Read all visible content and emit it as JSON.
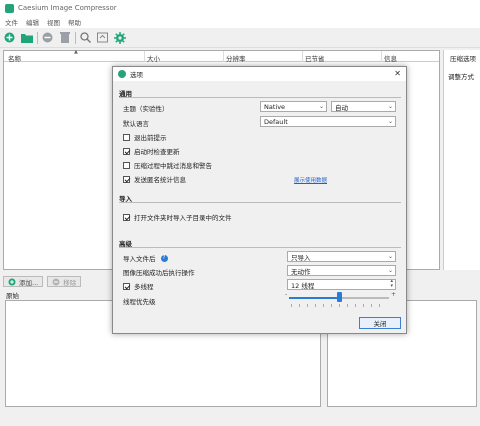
{
  "window": {
    "title": "Caesium Image Compressor"
  },
  "menu": [
    "文件",
    "编辑",
    "视图",
    "帮助"
  ],
  "toolbar": {
    "icons": [
      "add-icon",
      "folder-icon",
      "remove-icon",
      "clear-icon",
      "search-icon",
      "preview-icon",
      "settings-icon"
    ],
    "accent": "#1ea67a"
  },
  "table": {
    "columns": [
      "名称",
      "大小",
      "分辨率",
      "已节省",
      "信息"
    ]
  },
  "right_panel": {
    "title": "压缩选项",
    "tab": "调整方式"
  },
  "bottom": {
    "add_label": "添加...",
    "remove_label": "移除",
    "original_label": "原始"
  },
  "dialog": {
    "title": "选项",
    "general_section": "通用",
    "theme_label": "主题（实验性）",
    "theme_value": "Native",
    "theme_mode_value": "自动",
    "language_label": "默认语言",
    "language_value": "Default",
    "checkboxes": [
      {
        "label": "退出前提示",
        "checked": false
      },
      {
        "label": "启动时检查更新",
        "checked": true
      },
      {
        "label": "压缩过程中跳过消息和警告",
        "checked": false
      },
      {
        "label": "发送匿名统计信息",
        "checked": true
      }
    ],
    "show_data_link": "展示使用数据",
    "import_section": "导入",
    "import_subfolders": {
      "label": "打开文件夹时导入子目录中的文件",
      "checked": true
    },
    "advanced_section": "高级",
    "after_import_label": "导入文件后",
    "after_import_value": "只导入",
    "after_compress_label": "图像压缩成功后执行操作",
    "after_compress_value": "无动作",
    "multithread": {
      "label": "多线程",
      "checked": true
    },
    "threads_value": "12 线程",
    "priority_label": "线程优先级",
    "priority_level": 0.5,
    "close_label": "关闭"
  }
}
